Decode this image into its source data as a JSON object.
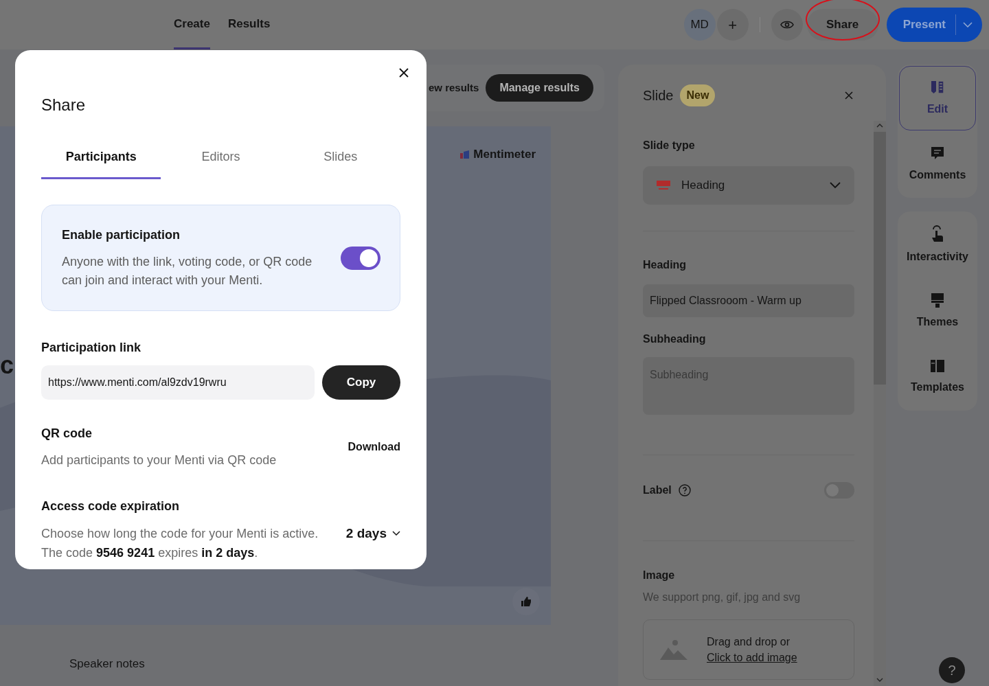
{
  "top_bar": {
    "tabs": [
      {
        "label": "Create",
        "selected": true
      },
      {
        "label": "Results",
        "selected": false
      }
    ],
    "avatar": "MD",
    "add_symbol": "+",
    "share": {
      "label": "Share",
      "circled": true
    },
    "present": "Present"
  },
  "toolbar": {
    "view_results": "ew results",
    "manage_results": "Manage results"
  },
  "slide_preview": {
    "logo": "Mentimeter",
    "heading_fragment": "c"
  },
  "speaker_notes": "Speaker notes",
  "slide_panel": {
    "title": "Slide",
    "badge": "New",
    "slide_type_label": "Slide type",
    "slide_type": "Heading",
    "heading_label": "Heading",
    "heading_value": "Flipped Classrooom - Warm up",
    "subheading_label": "Subheading",
    "subheading_placeholder": "Subheading",
    "label_text": "Label",
    "label_on": false,
    "image_label": "Image",
    "image_hint": "We support png, gif, jpg and svg",
    "drop_text": "Drag and drop or",
    "drop_link": "Click to add image"
  },
  "rail_groups": [
    [
      {
        "kind": "edit",
        "label": "Edit",
        "selected": true
      },
      {
        "kind": "comments",
        "label": "Comments",
        "selected": false
      }
    ],
    [
      {
        "kind": "interactivity",
        "label": "Interactivity",
        "selected": false
      },
      {
        "kind": "themes",
        "label": "Themes",
        "selected": false
      },
      {
        "kind": "templates",
        "label": "Templates",
        "selected": false
      }
    ]
  ],
  "help": "?",
  "share_dialog": {
    "title": "Share",
    "tabs": [
      {
        "label": "Participants",
        "selected": true
      },
      {
        "label": "Editors",
        "selected": false
      },
      {
        "label": "Slides",
        "selected": false
      }
    ],
    "participation": {
      "title": "Enable participation",
      "text": "Anyone with the link, voting code, or QR code can join and interact with your Menti.",
      "on": true
    },
    "link_label": "Participation link",
    "link": "https://www.menti.com/al9zdv19rwru",
    "copy": "Copy",
    "qr_title": "QR code",
    "qr_text": "Add participants to your Menti via QR code",
    "download": "Download",
    "expiry_title": "Access code expiration",
    "expiry_text": "Choose how long the code for your Menti is active.",
    "expiry_code_text": "The code **9546 9241** expires **in 2 days**.",
    "expiry_value": "2 days"
  }
}
